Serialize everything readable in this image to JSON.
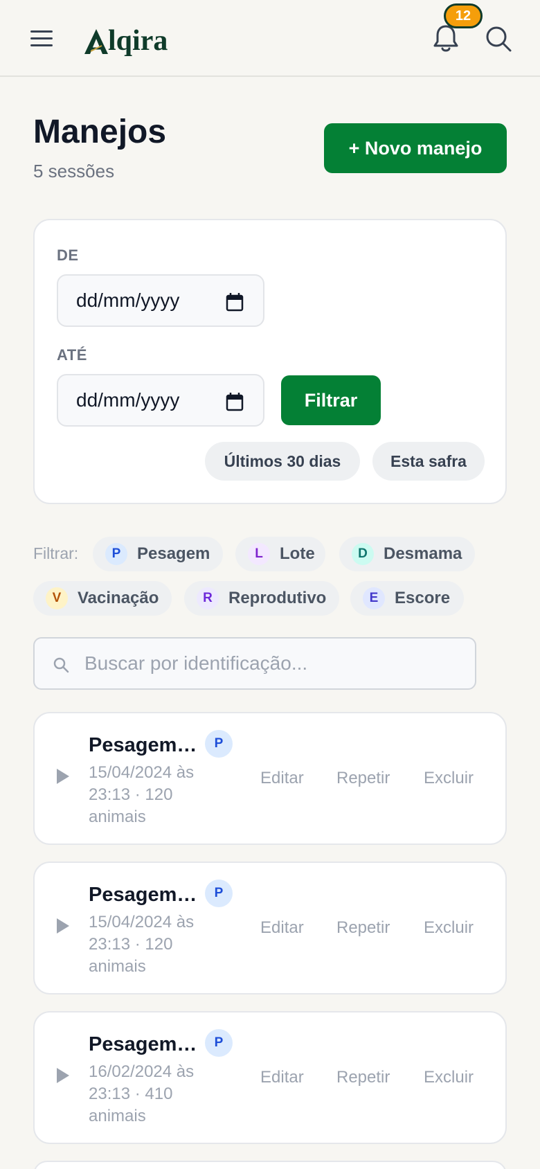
{
  "header": {
    "brand": "Alqira",
    "notification_count": "12"
  },
  "page": {
    "title": "Manejos",
    "subtitle": "5 sessões",
    "new_button": "+ Novo manejo"
  },
  "filters": {
    "from_label": "DE",
    "to_label": "ATÉ",
    "date_placeholder": "dd/mm/yyyy",
    "filter_button": "Filtrar",
    "quick": [
      "Últimos 30 dias",
      "Esta safra"
    ]
  },
  "type_filter": {
    "label": "Filtrar:",
    "types": [
      {
        "letter": "P",
        "label": "Pesagem",
        "color": "#1d4ed8",
        "bg": "#dbeafe"
      },
      {
        "letter": "L",
        "label": "Lote",
        "color": "#7e22ce",
        "bg": "#f3e8ff"
      },
      {
        "letter": "D",
        "label": "Desmama",
        "color": "#0f766e",
        "bg": "#ccfbf1"
      },
      {
        "letter": "V",
        "label": "Vacinação",
        "color": "#b45309",
        "bg": "#fef3c7"
      },
      {
        "letter": "R",
        "label": "Reprodutivo",
        "color": "#6d28d9",
        "bg": "#ede9fe"
      },
      {
        "letter": "E",
        "label": "Escore",
        "color": "#4338ca",
        "bg": "#e0e7ff"
      }
    ]
  },
  "search": {
    "placeholder": "Buscar por identificação..."
  },
  "sessions": [
    {
      "title": "Pesagem…",
      "badge": "P",
      "meta": "15/04/2024 às 23:13 · 120 animais"
    },
    {
      "title": "Pesagem…",
      "badge": "P",
      "meta": "15/04/2024 às 23:13 · 120 animais"
    },
    {
      "title": "Pesagem…",
      "badge": "P",
      "meta": "16/02/2024 às 23:13 · 410 animais"
    }
  ],
  "actions": {
    "edit": "Editar",
    "repeat": "Repetir",
    "delete": "Excluir"
  },
  "colors": {
    "primary": "#048035",
    "brand_dark": "#0f3b2a",
    "badge": "#f59e0b"
  }
}
